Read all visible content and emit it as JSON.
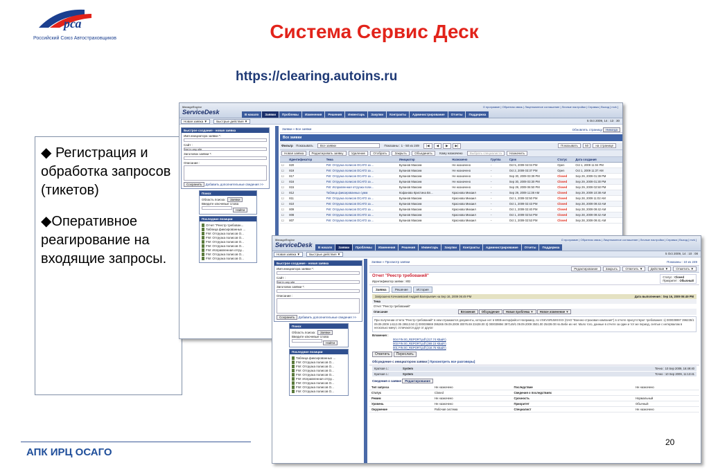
{
  "logo": {
    "text": "Российский Союз Автостраховщиков",
    "icon": "rsa-logo"
  },
  "slide": {
    "title": "Система Сервис Деск",
    "url": "https://clearing.autoins.ru",
    "bullets": [
      "◆ Регистрация и обработка запросов (тикетов)",
      "◆Оперативное реагирование на входящие запросы."
    ],
    "footer": "АПК ИРЦ ОСАГО",
    "page_number": "20"
  },
  "shot1": {
    "product": "ServiceDesk",
    "product_sub": "ManageEngine",
    "toplinks": "О программе | Обратная связь | Лицензионное соглашение | Личные настройки | Справка | Выход [ mvk ]",
    "nav": [
      "В начало",
      "Заявки",
      "Проблемы",
      "Изменения",
      "Решения",
      "Инвентарь",
      "Закупки",
      "Контракты",
      "Администрирование",
      "Отчеты",
      "Поддержка"
    ],
    "bar_buttons": [
      "Новая заявка ▼",
      "Быстрые действия ▼"
    ],
    "bar_date": "5 Oct 2009, 14 : 13 : 30",
    "quick_create": {
      "header": "Быстрое создание - новая заявка",
      "requester_label": "Имя инициатора заявки *:",
      "site_label": "Сайт :",
      "site_value": "Not in any site",
      "subject_label": "Заголовок заявки *:",
      "desc_label": "Описание :",
      "save": "Сохранить",
      "more": "Добавить дополнительные сведения >>"
    },
    "search": {
      "header": "Поиск",
      "area_label": "Область поиска :",
      "area_value": "Заявки",
      "keywords_label": "Введите ключевые слова",
      "find": "Найти"
    },
    "recent": {
      "header": "Последние позиции",
      "items": [
        "Отчет \"Реестр требован...",
        "Таблица фиксированных ...",
        "FW: Отгрузка полисов О...",
        "FW: Отгрузка полисов О...",
        "FW: Отгрузка полисов О...",
        "FW: Отгрузка полисов О...",
        "FW: Исправленная отгру...",
        "FW: Отгрузка полисов О...",
        "FW: Отгрузка полисов О..."
      ]
    },
    "breadcrumb": "Заявки » Все заявки",
    "refresh_label": "Обновлять страницу",
    "refresh_value": "Никогда",
    "section": "Все заявки",
    "filter_label": "Фильтр",
    "show_label": "Показывать",
    "show_value": "Все заявки",
    "range": "Показаны : 1 - 50 из 249",
    "per_page_label": "Показывать",
    "per_page_value": "50",
    "per_page_suffix": "на странице",
    "toolbar": [
      "Новая заявка",
      "Редактировать заявку",
      "Удаление",
      "Отобрать",
      "Закрыть",
      "Объединить",
      "Кому назначено",
      "Выбрать специалиста",
      "Назначить"
    ],
    "columns": [
      "",
      "Идентификатор",
      "Тема",
      "Инициатор",
      "Назначено",
      "Группа",
      "Срок",
      "Статус",
      "Дата создания"
    ],
    "rows": [
      [
        "",
        "820",
        "FW: Отгрузка полисов ОСАГО за ...",
        "Буланов Максим",
        "Не назначено",
        "-",
        "Oct 5, 2009 04:04 PM",
        "Open",
        "Oct 1, 2009 11:04 PM"
      ],
      [
        "",
        "819",
        "FW: Отгрузка полисов ОСАГО за ...",
        "Буланов Максим",
        "Не назначено",
        "-",
        "Oct 2, 2009 03:37 PM",
        "Open",
        "Oct 1, 2009 11:37 AM"
      ],
      [
        "",
        "817",
        "FW: Отгрузка полисов ОСАГО за ...",
        "Буланов Максим",
        "Не назначено",
        "-",
        "Sep 30, 2009 03:39 PM",
        "Closed",
        "Sep 29, 2009 01:39 PM"
      ],
      [
        "",
        "816",
        "FW: Отгрузка полисов ОСАГО за ...",
        "Буланов Максим",
        "Не назначено",
        "-",
        "Sep 30, 2009 03:30 PM",
        "Closed",
        "Sep 29, 2009 01:30 PM"
      ],
      [
        "",
        "815",
        "FW: Исправленная отгрузка поли...",
        "Буланов Максим",
        "Не назначено",
        "-",
        "Sep 29, 2009 06:50 PM",
        "Closed",
        "Sep 29, 2009 02:50 PM"
      ],
      [
        "",
        "812",
        "Таблица фиксированных сумм",
        "Кофанова Кристина Вл...",
        "Краснова Михаил",
        "-",
        "Sep 29, 2009 11:38 AM",
        "Closed",
        "Sep 29, 2009 10:38 AM"
      ],
      [
        "",
        "811",
        "FW: Отгрузка полисов ОСАГО за ...",
        "Буланов Максим",
        "Краснова Михаил",
        "-",
        "Oct 1, 2009 02:50 PM",
        "Closed",
        "Sep 28, 2009 11:02 AM"
      ],
      [
        "",
        "810",
        "FW: Отгрузка полисов ОСАГО за ...",
        "Буланов Максим",
        "Краснова Михаил",
        "-",
        "Oct 1, 2009 02:43 PM",
        "Closed",
        "Sep 28, 2009 09:43 AM"
      ],
      [
        "",
        "809",
        "FW: Отгрузка полисов ОСАГО за ...",
        "Буланов Максим",
        "Краснова Михаил",
        "-",
        "Oct 1, 2009 02:40 PM",
        "Closed",
        "Sep 28, 2009 09:42 AM"
      ],
      [
        "",
        "808",
        "FW: Отгрузка полисов ОСАГО за ...",
        "Буланов Максим",
        "Краснова Михаил",
        "-",
        "Oct 1, 2009 02:54 PM",
        "Closed",
        "Sep 28, 2009 09:42 AM"
      ],
      [
        "",
        "807",
        "FW: Отгрузка полисов ОСАГО за ...",
        "Буланов Максим",
        "Краснова Михаил",
        "-",
        "Oct 1, 2009 02:53 PM",
        "Closed",
        "Sep 28, 2009 09:41 AM"
      ]
    ]
  },
  "shot2": {
    "product": "ServiceDesk",
    "product_sub": "ManageEngine",
    "toplinks": "О программе | Обратная связь | Лицензионное соглашение | Личные настройки | Справка | Выход [ mvk ]",
    "nav": [
      "В начало",
      "Заявки",
      "Проблемы",
      "Изменения",
      "Решения",
      "Инвентарь",
      "Закупки",
      "Контракты",
      "Администрирование",
      "Отчеты",
      "Поддержка"
    ],
    "bar_buttons": [
      "Новая заявка ▼",
      "Быстрые действия ▼"
    ],
    "bar_date": "5 Oct 2009, 14 : 10 : 08",
    "breadcrumb": "Заявки » Просмотр заявки",
    "range": "Показаны : 10 из 249",
    "actions": [
      "Редактирование",
      "Закрыть",
      "Ответить ▼",
      "Действия ▼",
      "Отметить ▼"
    ],
    "request_title": "Отчет \"Реестр требований\"",
    "request_id": "Идентификатор заявки : 802",
    "status_label": "Статус :",
    "status_value": "Closed",
    "priority_label": "Приоритет :",
    "priority_value": "Обычный",
    "tabs": [
      "Заявка",
      "Решение",
      "История"
    ],
    "requester_line": "Запрошено Кочнаевский Андрей Валерьевич на Sep 16, 2009 06:49 PM",
    "due_line": "Дата выполнения : Sep 16, 2009 06:49 PM",
    "topic_label": "Тема",
    "topic_value": "Отчет \"Реестр требований\"",
    "desc_label": "Описание",
    "desc_buttons": [
      "Вложения",
      "Обсуждение",
      "Новая проблема ▼",
      "Новое изменение ▼"
    ],
    "desc_text": "При получении отчета \"Реестр требований\" в нем отражаются документы, которые нет в WEB-интерфейсе! Например, по VSKVSRUMXXXX (ОАО \"Военно-страховая компания\") в отчете присутствуют требования: 1) 000039997 396235/1 09.09.2009 14113.05 29513.50 2) 000039869 395265 09.09.2009 30076.69 23428.00 3) 000039894 397149/1 09.09.2009 3501.00 25439.00 На Вебе их нет. Мало того, данные в отчете за один и тот же период, снятые с интервалом в несколько минут, отличаются друг от друга!",
    "attach_label": "Вложения :",
    "attachments": [
      "004 FIN 00_REPORT.pdf (217.74 КБайт)",
      "003 FIN 00_REPORT.pdf (269.15 КБайт)",
      "001 FIN 00_REPORT.pdf (216.75 КБайт)"
    ],
    "reply_buttons": [
      "Ответить",
      "Переслать"
    ],
    "discussion_label": "Обсуждение с инициатором заявки",
    "discussion_link": "[ Просмотреть все разговоры]",
    "discussion_rows": [
      [
        "Краткая с.:",
        "System",
        "Точно : 10 Sep 2009, 16:49:40"
      ],
      [
        "Краткая с.:",
        "System",
        "Точно : 10 Sep 2009, 11:13:41"
      ]
    ],
    "details_label": "Сведения о заявке",
    "details_button": "Редактирование",
    "details": [
      [
        "Тип запроса",
        "Не назначено",
        "Последствие",
        "Не назначено"
      ],
      [
        "Статус",
        "Closed",
        "Сведения о последствиях",
        ""
      ],
      [
        "Режим",
        "Не назначено",
        "Срочность",
        "Нормальный"
      ],
      [
        "Уровень",
        "Не назначено",
        "Приоритет",
        "Обычный"
      ],
      [
        "Окружение",
        "Рабочая система",
        "Специалист",
        "Не назначено"
      ]
    ],
    "quick_create_header": "Быстрое создание - новая заявка",
    "search_header": "Поиск",
    "search_area": "Заявки",
    "recent_header": "Последние позиции",
    "recent_items": [
      "Таблица фиксированных ...",
      "FW: Отгрузка полисов О...",
      "FW: Отгрузка полисов О...",
      "FW: Отгрузка полисов О...",
      "FW: Отгрузка полисов О...",
      "FW: Исправленная отгру...",
      "FW: Отгрузка полисов О...",
      "FW: Отгрузка полисов О...",
      "FW: Отгрузка полисов О..."
    ]
  },
  "colors": {
    "title_red": "#e2231a",
    "url_blue": "#1f3a76",
    "nav_blue": "#3a5a9c",
    "footer_blue": "#1f4e9a"
  }
}
